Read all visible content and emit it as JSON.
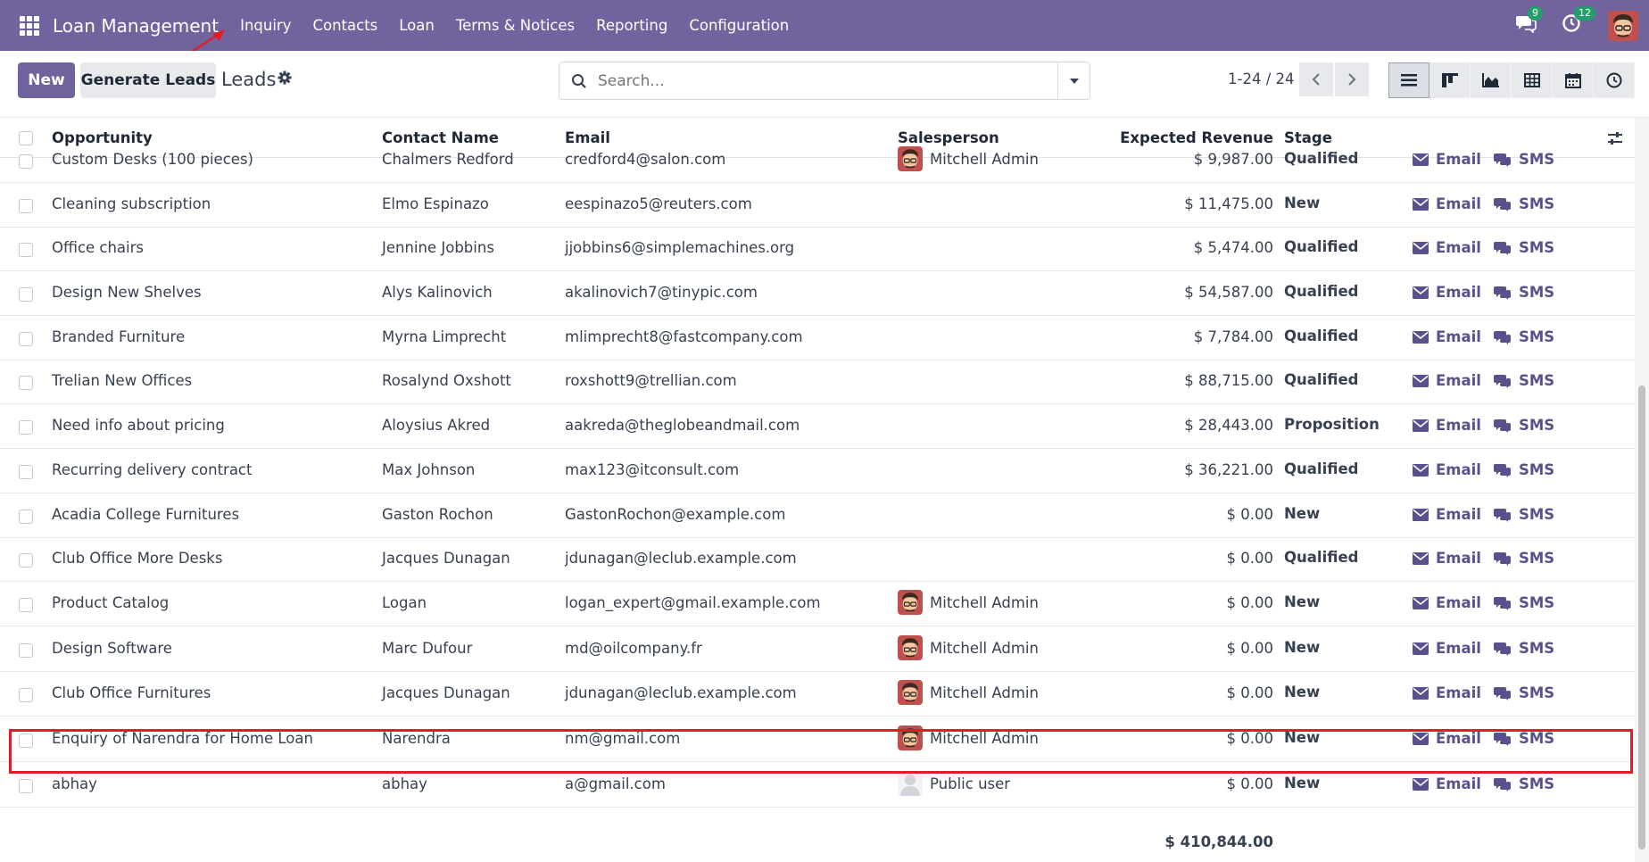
{
  "app": {
    "title": "Loan Management"
  },
  "menu": [
    "Inquiry",
    "Contacts",
    "Loan",
    "Terms & Notices",
    "Reporting",
    "Configuration"
  ],
  "systray": {
    "messages_count": "9",
    "activities_count": "12"
  },
  "toolbar": {
    "new_label": "New",
    "generate_label": "Generate Leads",
    "title": "Leads"
  },
  "search": {
    "placeholder": "Search..."
  },
  "pager": {
    "value": "1-24 / 24"
  },
  "table": {
    "headers": {
      "opportunity": "Opportunity",
      "contact": "Contact Name",
      "email": "Email",
      "salesperson": "Salesperson",
      "revenue": "Expected Revenue",
      "stage": "Stage"
    },
    "action_email": "Email",
    "action_sms": "SMS",
    "rows": [
      {
        "opportunity": "Custom Desks (100 pieces)",
        "contact": "Chalmers Redford",
        "email": "credford4@salon.com",
        "salesperson": "Mitchell Admin",
        "revenue": "$ 9,987.00",
        "stage": "Qualified"
      },
      {
        "opportunity": "Cleaning subscription",
        "contact": "Elmo Espinazo",
        "email": "eespinazo5@reuters.com",
        "salesperson": "",
        "revenue": "$ 11,475.00",
        "stage": "New"
      },
      {
        "opportunity": "Office chairs",
        "contact": "Jennine Jobbins",
        "email": "jjobbins6@simplemachines.org",
        "salesperson": "",
        "revenue": "$ 5,474.00",
        "stage": "Qualified"
      },
      {
        "opportunity": "Design New Shelves",
        "contact": "Alys Kalinovich",
        "email": "akalinovich7@tinypic.com",
        "salesperson": "",
        "revenue": "$ 54,587.00",
        "stage": "Qualified"
      },
      {
        "opportunity": "Branded Furniture",
        "contact": "Myrna Limprecht",
        "email": "mlimprecht8@fastcompany.com",
        "salesperson": "",
        "revenue": "$ 7,784.00",
        "stage": "Qualified"
      },
      {
        "opportunity": "Trelian New Offices",
        "contact": "Rosalynd Oxshott",
        "email": "roxshott9@trellian.com",
        "salesperson": "",
        "revenue": "$ 88,715.00",
        "stage": "Qualified"
      },
      {
        "opportunity": "Need info about pricing",
        "contact": "Aloysius Akred",
        "email": "aakreda@theglobeandmail.com",
        "salesperson": "",
        "revenue": "$ 28,443.00",
        "stage": "Proposition"
      },
      {
        "opportunity": "Recurring delivery contract",
        "contact": "Max Johnson",
        "email": "max123@itconsult.com",
        "salesperson": "",
        "revenue": "$ 36,221.00",
        "stage": "Qualified"
      },
      {
        "opportunity": "Acadia College Furnitures",
        "contact": "Gaston Rochon",
        "email": "GastonRochon@example.com",
        "salesperson": "",
        "revenue": "$ 0.00",
        "stage": "New"
      },
      {
        "opportunity": "Club Office More Desks",
        "contact": "Jacques Dunagan",
        "email": "jdunagan@leclub.example.com",
        "salesperson": "",
        "revenue": "$ 0.00",
        "stage": "Qualified"
      },
      {
        "opportunity": "Product Catalog",
        "contact": "Logan",
        "email": "logan_expert@gmail.example.com",
        "salesperson": "Mitchell Admin",
        "revenue": "$ 0.00",
        "stage": "New"
      },
      {
        "opportunity": "Design Software",
        "contact": "Marc Dufour",
        "email": "md@oilcompany.fr",
        "salesperson": "Mitchell Admin",
        "revenue": "$ 0.00",
        "stage": "New"
      },
      {
        "opportunity": "Club Office Furnitures",
        "contact": "Jacques Dunagan",
        "email": "jdunagan@leclub.example.com",
        "salesperson": "Mitchell Admin",
        "revenue": "$ 0.00",
        "stage": "New"
      },
      {
        "opportunity": "Enquiry of Narendra for Home Loan",
        "contact": "Narendra",
        "email": "nm@gmail.com",
        "salesperson": "Mitchell Admin",
        "revenue": "$ 0.00",
        "stage": "New"
      },
      {
        "opportunity": "abhay",
        "contact": "abhay",
        "email": "a@gmail.com",
        "salesperson": "Public user",
        "revenue": "$ 0.00",
        "stage": "New"
      }
    ],
    "total": "$ 410,844.00"
  },
  "colors": {
    "navbar": "#71639e",
    "accent": "#5b4f8c",
    "highlight": "#e11d2a"
  }
}
